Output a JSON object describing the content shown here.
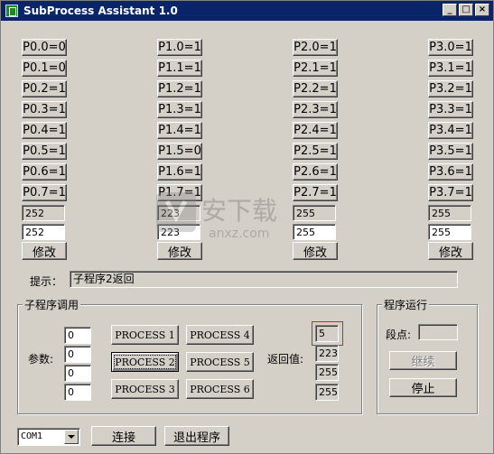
{
  "window": {
    "title": "SubProcess Assistant 1.0",
    "minimize": "_",
    "maximize": "□",
    "close": "×"
  },
  "ports": {
    "p0": [
      "P0.0=0",
      "P0.1=0",
      "P0.2=1",
      "P0.3=1",
      "P0.4=1",
      "P0.5=1",
      "P0.6=1",
      "P0.7=1"
    ],
    "p1": [
      "P1.0=1",
      "P1.1=1",
      "P1.2=1",
      "P1.3=1",
      "P1.4=1",
      "P1.5=0",
      "P1.6=1",
      "P1.7=1"
    ],
    "p2": [
      "P2.0=1",
      "P2.1=1",
      "P2.2=1",
      "P2.3=1",
      "P2.4=1",
      "P2.5=1",
      "P2.6=1",
      "P2.7=1"
    ],
    "p3": [
      "P3.0=1",
      "P3.1=1",
      "P3.2=1",
      "P3.3=1",
      "P3.4=1",
      "P3.5=1",
      "P3.6=1",
      "P3.7=1"
    ]
  },
  "port_values": {
    "p0": {
      "current": "252",
      "input": "252"
    },
    "p1": {
      "current": "223",
      "input": "223"
    },
    "p2": {
      "current": "255",
      "input": "255"
    },
    "p3": {
      "current": "255",
      "input": "255"
    }
  },
  "modify_label": "修改",
  "hint": {
    "label": "提示：",
    "value": "子程序2返回"
  },
  "subroutine": {
    "group_title": "子程序调用",
    "params_label": "参数:",
    "params": [
      "0",
      "0",
      "0",
      "0"
    ],
    "process_buttons": [
      "PROCESS 1",
      "PROCESS 2",
      "PROCESS 3",
      "PROCESS 4",
      "PROCESS 5",
      "PROCESS 6"
    ],
    "return_label": "返回值:",
    "returns": [
      "5",
      "223",
      "255",
      "255"
    ]
  },
  "run": {
    "group_title": "程序运行",
    "breakpoint_label": "段点:",
    "breakpoint_value": "",
    "continue_label": "继续",
    "stop_label": "停止"
  },
  "bottom": {
    "com_port": "COM1",
    "connect_label": "连接",
    "exit_label": "退出程序"
  },
  "watermark": {
    "text1": "安下载",
    "text2": "anxz.com"
  },
  "colors": {
    "titlebar": "#0a246a",
    "face": "#d4d0c8",
    "highlight": "#e02020"
  }
}
